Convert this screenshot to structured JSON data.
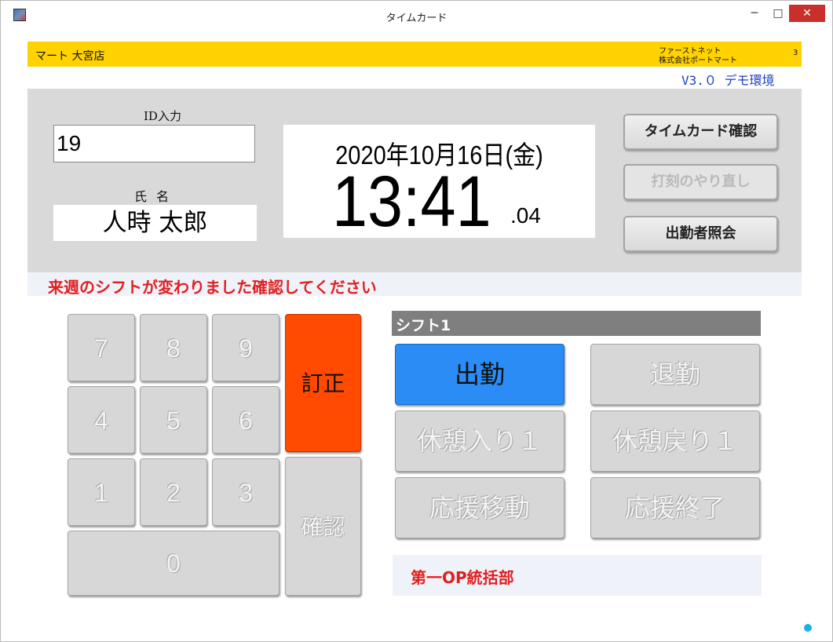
{
  "window": {
    "title": "タイムカード",
    "minimize_glyph": "─",
    "maximize_glyph": "□",
    "close_glyph": "✕"
  },
  "header": {
    "store_name": "マート 大宮店",
    "company_line1": "ファーストネット",
    "company_line2": "株式会社ポートマート",
    "terminal_no": "3",
    "version": "V3.０ デモ環境"
  },
  "input": {
    "id_label": "ID入力",
    "id_value": "19",
    "name_label": "氏名",
    "name_value": "人時 太郎"
  },
  "clock": {
    "date": "2020年10月16日(金)",
    "time": "13:41",
    "seconds": ".04"
  },
  "side_buttons": {
    "timecard_check": "タイムカード確認",
    "redo_stamp": "打刻のやり直し",
    "attendance_query": "出勤者照会"
  },
  "notice": "来週のシフトが変わりました確認してください",
  "keypad": {
    "k7": "7",
    "k8": "8",
    "k9": "9",
    "k4": "4",
    "k5": "5",
    "k6": "6",
    "k1": "1",
    "k2": "2",
    "k3": "3",
    "k0": "0",
    "correct": "訂正",
    "confirm": "確認"
  },
  "shift": {
    "title": "シフト1",
    "clock_in": "出勤",
    "clock_out": "退勤",
    "break_in": "休憩入り１",
    "break_out": "休憩戻り１",
    "support_move": "応援移動",
    "support_end": "応援終了"
  },
  "department": "第一OP統括部",
  "colors": {
    "header_bar": "#ffd200",
    "correct_button": "#ff4a00",
    "active_button": "#2a8cf4",
    "notice_text": "#e02020",
    "status_dot": "#18b4e8"
  }
}
